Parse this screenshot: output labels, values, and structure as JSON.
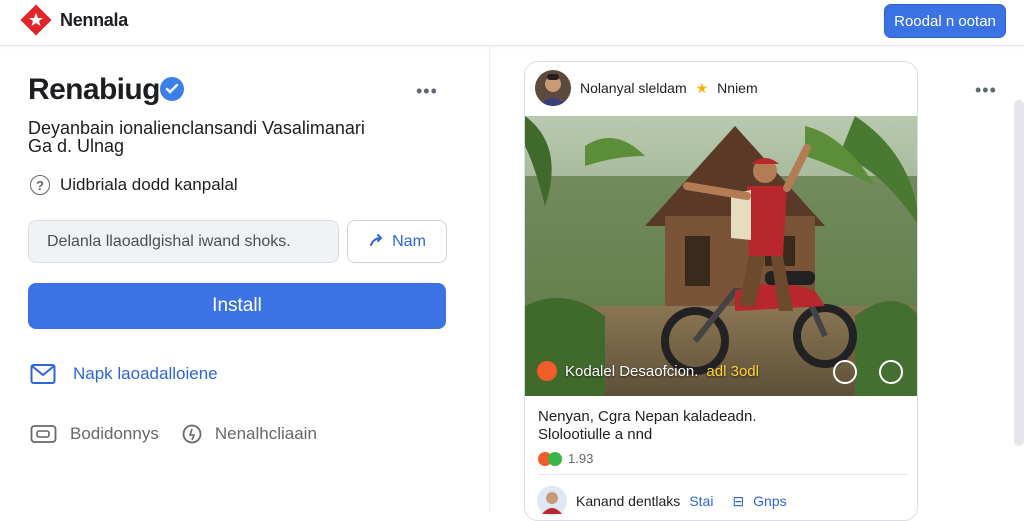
{
  "header": {
    "brand": "Nennala",
    "action_button": "Roodal n ootan"
  },
  "profile": {
    "name": "Renabiug",
    "description_line1": "Deyanbain ionalienclansandi Vasalimanari",
    "description_line2": "Ga d. Ulnag",
    "help_text": "Uidbriala dodd kanpalal",
    "search_placeholder": "Delanla llaoadlgishal iwand shoks.",
    "name_button": "Nam",
    "install_button": "Install",
    "mail_link": "Napk laoadalloiene",
    "bottom_left": "Bodidonnys",
    "bottom_right": "Nenalhcliaain"
  },
  "post": {
    "author": "Nolanyal sleldam",
    "author_suffix": "Nniem",
    "caption": "Kodalel Desaofcion.",
    "caption_highlight": "adl 3odl",
    "text_line1": "Nenyan, Cgra Nepan kaladeadn.",
    "text_line2": "Slolootiulle a nnd",
    "reaction_count": "1.93",
    "commenter": "Kanand dentlaks",
    "commenter_tag": "Stai",
    "comment_action": "Gnps"
  },
  "colors": {
    "accent": "#3b73e4",
    "link": "#2e66d8",
    "logo_red": "#e0262b"
  },
  "icons": [
    "star-logo-icon",
    "verified-icon",
    "help-icon",
    "share-icon",
    "mail-icon",
    "card-icon",
    "pin-icon",
    "more-icon"
  ]
}
